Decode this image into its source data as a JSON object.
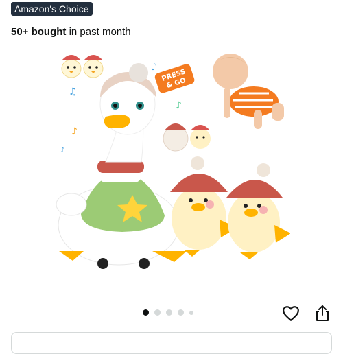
{
  "badge": {
    "text": "Amazon's Choice"
  },
  "purchase_stat": {
    "count": "50+ bought",
    "suffix": " in past month"
  },
  "image": {
    "sticker_line1": "PRESS",
    "sticker_line2": "& GO"
  },
  "carousel": {
    "total": 5,
    "active": 1
  },
  "icons": {
    "favorite": "heart-icon",
    "share": "share-icon"
  }
}
